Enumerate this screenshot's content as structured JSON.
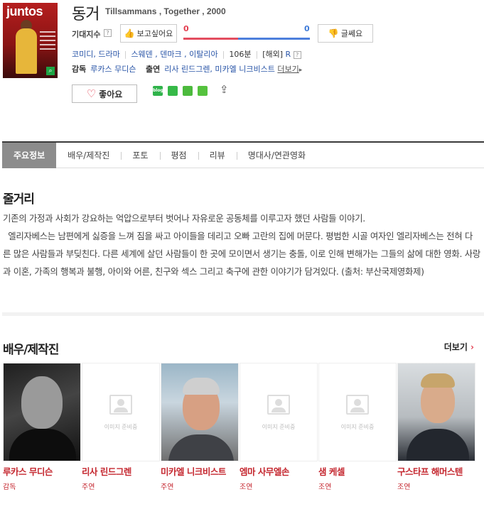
{
  "poster": {
    "title": "juntos"
  },
  "movie": {
    "title": "동거",
    "subtitle": "Tillsammans , Together , 2000"
  },
  "expectation": {
    "label": "기대지수",
    "help": "?",
    "want_label": "보고싶어요",
    "no_label": "글쎄요",
    "want_count": "0",
    "no_count": "0"
  },
  "meta": {
    "genre": "코미디, 드라마",
    "countries": "스웨덴 , 덴마크 , 이탈리아",
    "runtime": "106분",
    "rating_prefix": "[해외]",
    "rating": "R",
    "help": "?"
  },
  "credits": {
    "director_label": "감독",
    "director": "루카스 무디슨",
    "cast_label": "출연",
    "cast": "리사 린드그렌, 미카엘 니크비스트",
    "more": "더보기"
  },
  "actions": {
    "like_label": "좋아요",
    "sns": [
      "blog",
      "c",
      "k",
      "f"
    ]
  },
  "tabs": [
    "주요정보",
    "배우/제작진",
    "포토",
    "평점",
    "리뷰",
    "명대사/연관영화"
  ],
  "synopsis": {
    "title": "줄거리",
    "lines": [
      "기존의 가정과 사회가 강요하는 억압으로부터 벗어나 자유로운 공동체를 이루고자 했던 사람들 이야기.",
      "  엘리자베스는 남편에게 싫증을 느껴 짐을 싸고 아이들을 데리고 오빠 고란의 집에 머문다. 평범한 시골 여자인 엘리자베스는 전혀 다른 많은 사람들과 부딪친다. 다른 세계에 살던 사람들이 한 곳에 모이면서 생기는 충돌, 이로 인해 변해가는 그들의 삶에 대한 영화. 사랑과 이혼, 가족의 행복과 불행, 아이와 어른, 친구와 섹스 그리고 축구에 관한 이야기가 담겨있다. (출처: 부산국제영화제)"
    ]
  },
  "cast_section": {
    "title": "배우/제작진",
    "more": "더보기",
    "placeholder_text": "이미지 준비중",
    "people": [
      {
        "name": "루카스 무디슨",
        "role": "감독",
        "photo": "real1"
      },
      {
        "name": "리사 린드그렌",
        "role": "주연",
        "photo": "none"
      },
      {
        "name": "미카엘 니크비스트",
        "role": "주연",
        "photo": "real2"
      },
      {
        "name": "엠마 사무엘손",
        "role": "조연",
        "photo": "none"
      },
      {
        "name": "샘 케셀",
        "role": "조연",
        "photo": "none"
      },
      {
        "name": "구스타프 해머스텐",
        "role": "조연",
        "photo": "real3"
      }
    ]
  },
  "colors": {
    "accent_red": "#c4262e",
    "link_blue": "#2854a7",
    "bar_red": "#e34d5f",
    "bar_blue": "#4d7fdc",
    "tab_active": "#8c8c8c"
  }
}
